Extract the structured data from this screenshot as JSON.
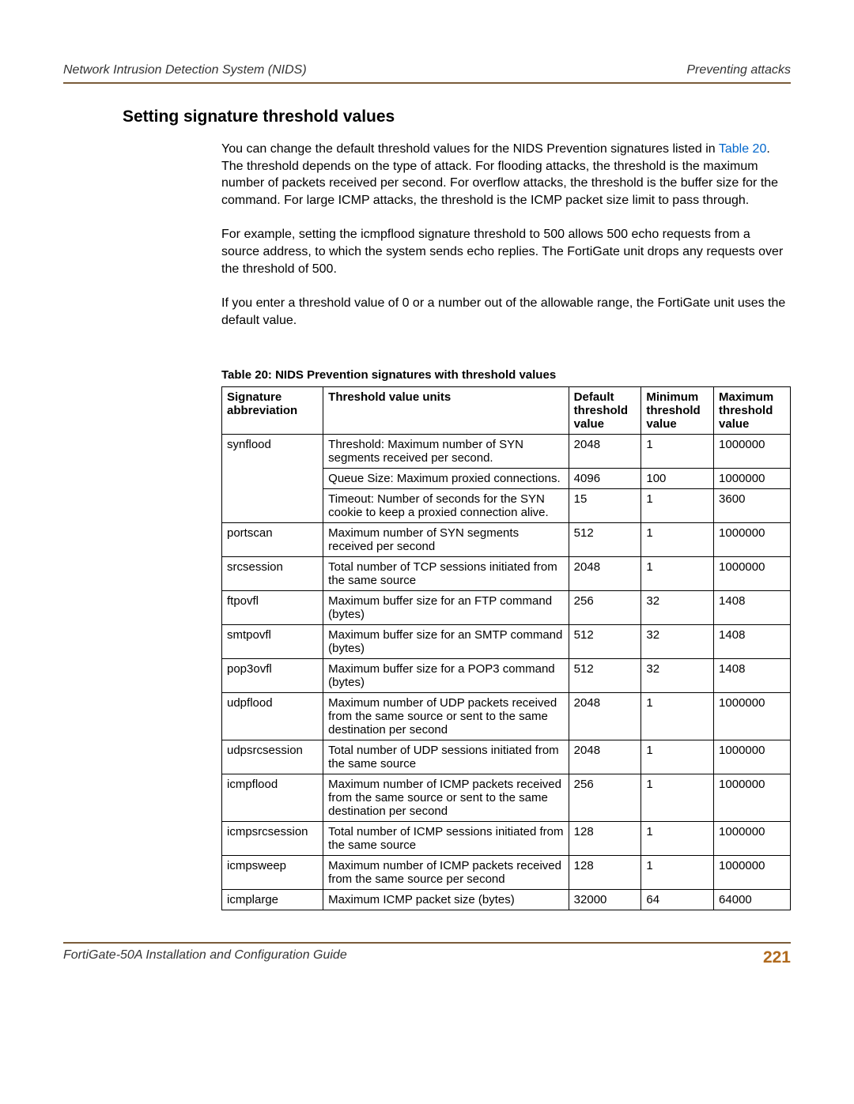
{
  "header": {
    "left": "Network Intrusion Detection System (NIDS)",
    "right": "Preventing attacks"
  },
  "section_title": "Setting signature threshold values",
  "paragraphs": {
    "p1_a": "You can change the default threshold values for the NIDS Prevention signatures listed in ",
    "p1_link": "Table 20",
    "p1_b": ". The threshold depends on the type of attack. For flooding attacks, the threshold is the maximum number of packets received per second. For overflow attacks, the threshold is the buffer size for the command. For large ICMP attacks, the threshold is the ICMP packet size limit to pass through.",
    "p2": "For example, setting the icmpflood signature threshold to 500 allows 500 echo requests from a source address, to which the system sends echo replies. The FortiGate unit drops any requests over the threshold of 500.",
    "p3": "If you enter a threshold value of 0 or a number out of the allowable range, the FortiGate unit uses the default value."
  },
  "table": {
    "caption": "Table 20:  NIDS Prevention signatures with threshold values",
    "headers": {
      "sig": "Signature abbreviation",
      "units": "Threshold value units",
      "def": "Default threshold value",
      "min": "Minimum threshold value",
      "max": "Maximum threshold value"
    },
    "rows": [
      {
        "sig": "synflood",
        "units": "Threshold: Maximum number of SYN segments received per second.",
        "def": "2048",
        "min": "1",
        "max": "1000000"
      },
      {
        "sig": "",
        "units": "Queue Size: Maximum proxied connections.",
        "def": "4096",
        "min": "100",
        "max": "1000000"
      },
      {
        "sig": "",
        "units": "Timeout: Number of seconds for the SYN cookie to keep a proxied connection alive.",
        "def": "15",
        "min": "1",
        "max": "3600"
      },
      {
        "sig": "portscan",
        "units": "Maximum number of SYN segments received per second",
        "def": "512",
        "min": "1",
        "max": "1000000"
      },
      {
        "sig": "srcsession",
        "units": "Total number of TCP sessions initiated from the same source",
        "def": "2048",
        "min": "1",
        "max": "1000000"
      },
      {
        "sig": "ftpovfl",
        "units": "Maximum buffer size for an FTP command (bytes)",
        "def": "256",
        "min": "32",
        "max": "1408"
      },
      {
        "sig": "smtpovfl",
        "units": "Maximum buffer size for an SMTP command (bytes)",
        "def": "512",
        "min": "32",
        "max": "1408"
      },
      {
        "sig": "pop3ovfl",
        "units": "Maximum buffer size for a POP3 command (bytes)",
        "def": "512",
        "min": "32",
        "max": "1408"
      },
      {
        "sig": "udpflood",
        "units": "Maximum number of UDP packets received from the same source or sent to the same destination per second",
        "def": "2048",
        "min": "1",
        "max": "1000000"
      },
      {
        "sig": "udpsrcsession",
        "units": "Total number of UDP sessions initiated from the same source",
        "def": "2048",
        "min": "1",
        "max": "1000000"
      },
      {
        "sig": "icmpflood",
        "units": "Maximum number of ICMP packets received from the same source or sent to the same destination per second",
        "def": "256",
        "min": "1",
        "max": "1000000"
      },
      {
        "sig": "icmpsrcsession",
        "units": "Total number of ICMP sessions initiated from the same source",
        "def": "128",
        "min": "1",
        "max": "1000000"
      },
      {
        "sig": "icmpsweep",
        "units": "Maximum number of ICMP packets received from the same source per second",
        "def": "128",
        "min": "1",
        "max": "1000000"
      },
      {
        "sig": "icmplarge",
        "units": "Maximum ICMP packet size (bytes)",
        "def": "32000",
        "min": "64",
        "max": "64000"
      }
    ]
  },
  "footer": {
    "left": "FortiGate-50A Installation and Configuration Guide",
    "right": "221"
  }
}
